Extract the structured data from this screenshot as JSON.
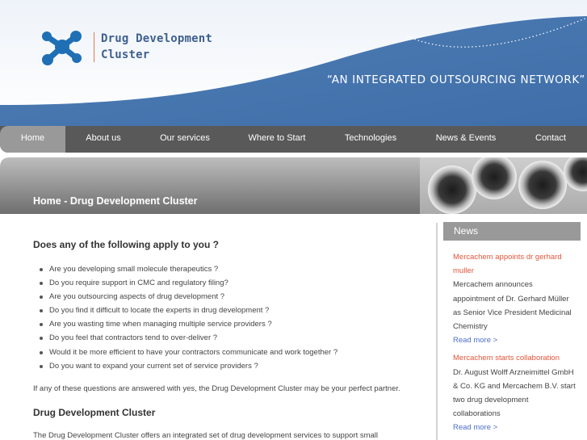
{
  "brand": {
    "line1": "Drug Development",
    "line2": "Cluster"
  },
  "tagline": "“AN INTEGRATED OUTSOURCING NETWORK”",
  "nav": [
    {
      "label": "Home",
      "active": true
    },
    {
      "label": "About us"
    },
    {
      "label": "Our services"
    },
    {
      "label": "Where to Start"
    },
    {
      "label": "Technologies"
    },
    {
      "label": "News & Events"
    },
    {
      "label": "Contact"
    }
  ],
  "banner": {
    "title": "Home - Drug Development Cluster"
  },
  "main": {
    "heading1": "Does any of the following apply to you ?",
    "bullets": [
      "Are you developing small molecule therapeutics ?",
      "Do you require support in CMC and regulatory filing?",
      "Are you outsourcing aspects of drug development ?",
      "Do you find it difficult to locate the experts in drug development ?",
      "Are you wasting time when managing multiple service providers ?",
      "Do you feel that contractors tend to over-deliver ?",
      "Would it be more efficient to have your contractors communicate and work together ?",
      "Do you want to expand your current set of service providers ?"
    ],
    "paragraph1": "If any of these questions are answered with yes, the Drug Development Cluster may be your perfect partner.",
    "heading2": "Drug Development Cluster",
    "paragraph2": "The Drug Development Cluster offers an integrated set of drug development services to support small"
  },
  "news": {
    "heading": "News",
    "items": [
      {
        "title_l1": "Mercachem appoints dr gerhard",
        "title_l2": "muller",
        "body_l1": "Mercachem announces",
        "body_l2": "appointment of Dr. Gerhard Müller",
        "body_l3": "as Senior Vice President Medicinal",
        "body_l4": "Chemistry",
        "more": "Read more >"
      },
      {
        "title_l1": "Mercachem starts collaboration",
        "body_l1": "Dr. August Wolff Arzneimittel GmbH",
        "body_l2": "& Co. KG and Mercachem B.V. start",
        "body_l3": "two drug development",
        "body_l4": "collaborations",
        "more": "Read more >"
      }
    ]
  },
  "colors": {
    "header_blue": "#4d79b0",
    "nav_gray": "#595959",
    "active_gray": "#999999",
    "news_red": "#e0563a",
    "link_blue": "#4b6fc6"
  }
}
